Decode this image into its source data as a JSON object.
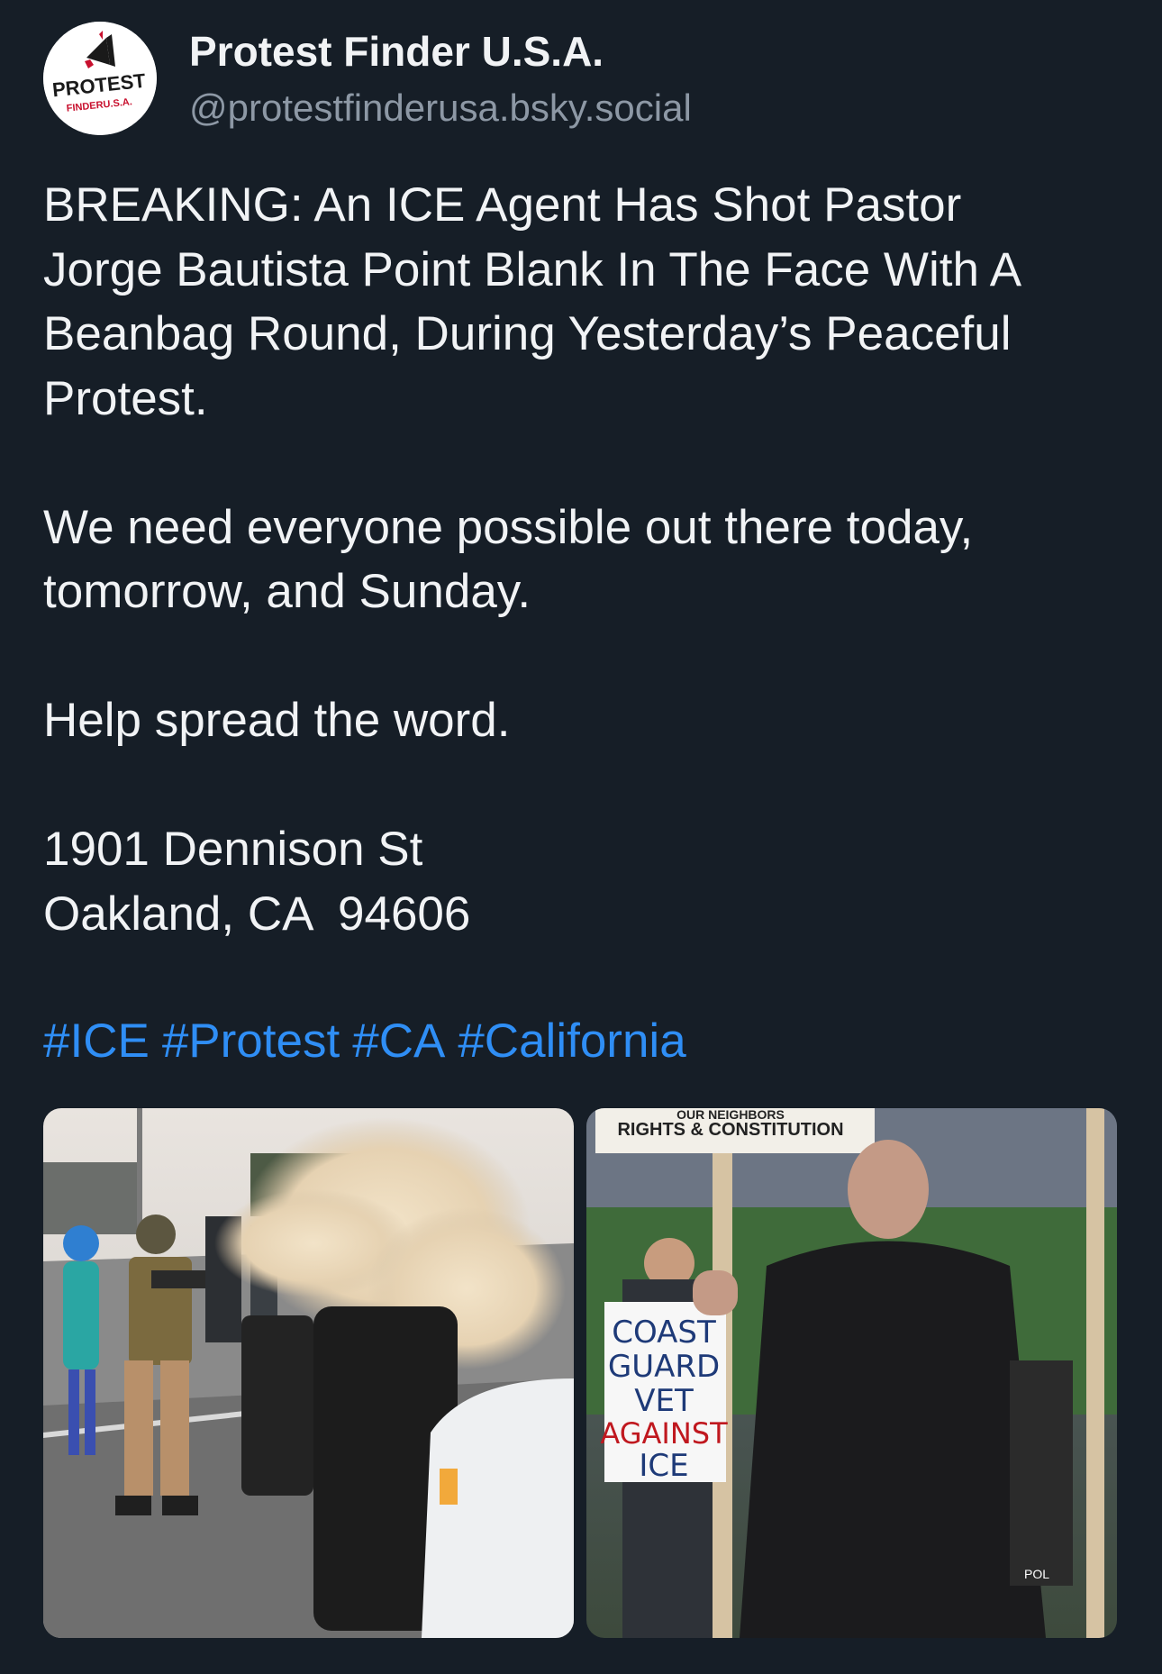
{
  "author": {
    "display_name": "Protest Finder U.S.A.",
    "handle": "@protestfinderusa.bsky.social",
    "avatar": {
      "logo_text_top": "PROTEST",
      "logo_text_bottom": "FINDERU.S.A.",
      "icon": "megaphone-icon"
    }
  },
  "post": {
    "paragraphs": [
      [
        "BREAKING: An ICE Agent Has Shot Pastor",
        "Jorge Bautista Point Blank In The Face With A",
        "Beanbag Round, During Yesterday’s Peaceful",
        "Protest."
      ],
      [
        "We need everyone possible out there today,",
        "tomorrow, and Sunday."
      ],
      [
        "Help spread the word."
      ],
      [
        "1901 Dennison St",
        "Oakland, CA  94606"
      ]
    ],
    "hashtags": [
      "#ICE",
      "#Protest",
      "#CA",
      "#California"
    ]
  },
  "images": {
    "left_sign_text": "",
    "right_top_sign_line1": "OUR NEIGHBORS",
    "right_top_sign_line2": "RIGHTS & CONSTITUTION",
    "right_hand_sign": [
      "COAST",
      "GUARD",
      "VET",
      "AGAINST",
      "ICE"
    ],
    "right_corner_sign": "POL"
  },
  "colors": {
    "background": "#161e27",
    "text": "#f1f3f5",
    "handle": "#8d98a5",
    "link": "#2f8ef5"
  }
}
